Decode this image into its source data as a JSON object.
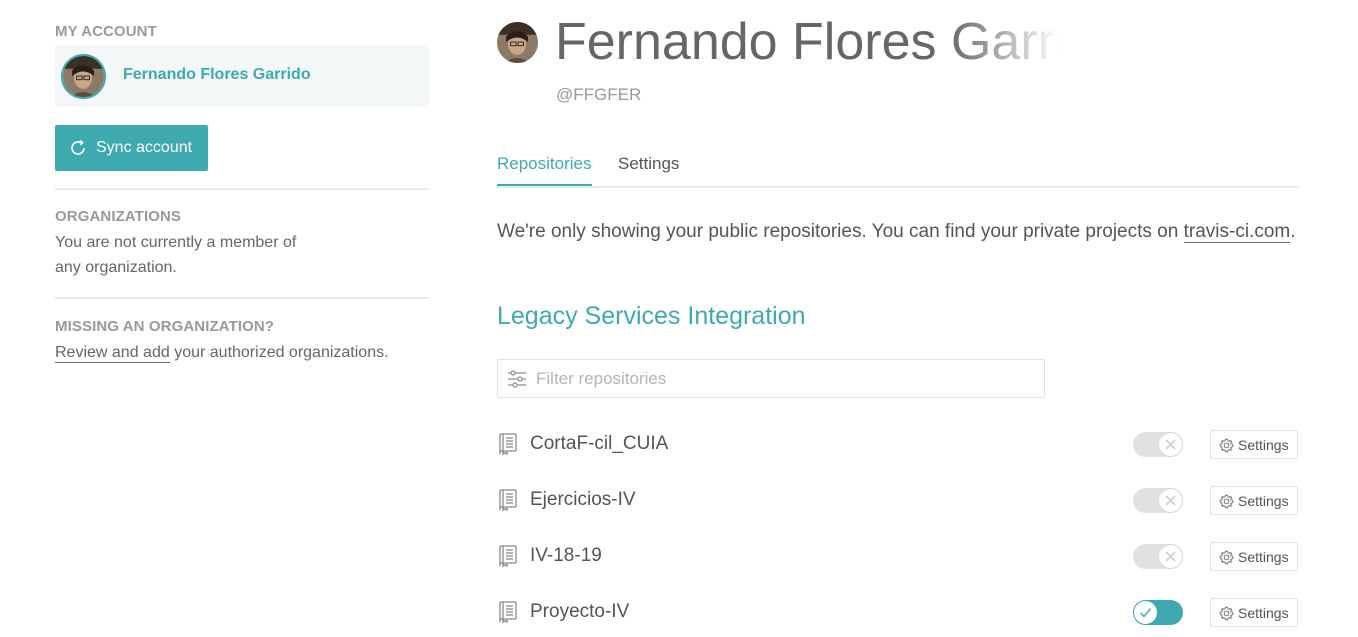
{
  "sidebar": {
    "my_account_heading": "MY ACCOUNT",
    "account_name": "Fernando Flores Garrido",
    "sync_label": "Sync account",
    "organizations_heading": "ORGANIZATIONS",
    "organizations_text_1": "You are not currently a member of",
    "organizations_text_2": "any organization.",
    "missing_heading": "MISSING AN ORGANIZATION?",
    "review_link": "Review and add",
    "review_rest": " your authorized organizations."
  },
  "profile": {
    "name": "Fernando Flores Garrido",
    "handle": "@FFGFER"
  },
  "tabs": [
    {
      "label": "Repositories",
      "active": true
    },
    {
      "label": "Settings",
      "active": false
    }
  ],
  "notice": {
    "text": "We're only showing your public repositories. You can find your private projects on ",
    "link": "travis-ci.com",
    "end": "."
  },
  "section_title": "Legacy Services Integration",
  "filter": {
    "placeholder": "Filter repositories",
    "value": ""
  },
  "repositories": [
    {
      "name": "CortaF-cil_CUIA",
      "enabled": false,
      "settings_label": "Settings"
    },
    {
      "name": "Ejercicios-IV",
      "enabled": false,
      "settings_label": "Settings"
    },
    {
      "name": "IV-18-19",
      "enabled": false,
      "settings_label": "Settings"
    },
    {
      "name": "Proyecto-IV",
      "enabled": true,
      "settings_label": "Settings"
    }
  ],
  "colors": {
    "accent": "#3eaaaf",
    "text": "#666666",
    "muted": "#9a9a9a",
    "toggle_off": "#e1e1e1"
  },
  "icons": {
    "sync": "sync-icon",
    "filter": "filter-sliders-icon",
    "repo": "repo-book-icon",
    "toggle_off": "x-icon",
    "toggle_on": "check-icon",
    "settings": "gear-icon"
  }
}
